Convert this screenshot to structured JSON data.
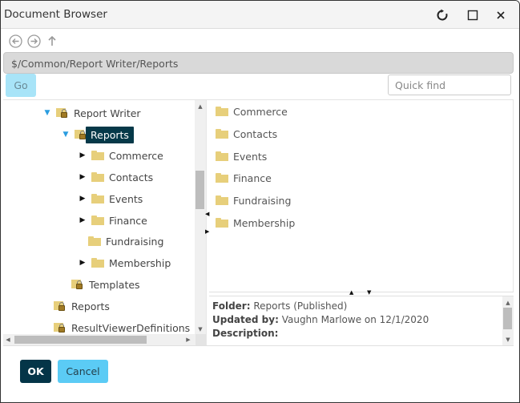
{
  "window": {
    "title": "Document Browser",
    "controls": [
      {
        "name": "refresh",
        "icon": "refresh-icon"
      },
      {
        "name": "maximize",
        "icon": "maximize-icon"
      },
      {
        "name": "close",
        "icon": "close-icon"
      }
    ]
  },
  "nav": {
    "back_icon": "back-circle-arrow-icon",
    "forward_icon": "forward-circle-arrow-icon",
    "up_icon": "up-arrow-icon"
  },
  "path": {
    "value": "$/Common/Report Writer/Reports"
  },
  "go_label": "Go",
  "quickfind": {
    "placeholder": "Quick find",
    "value": ""
  },
  "tree": {
    "items": [
      {
        "label": "Report Writer",
        "level": 0,
        "toggle": "open",
        "icon": "locked-folder-icon"
      },
      {
        "label": "Reports",
        "level": 1,
        "toggle": "open",
        "icon": "locked-folder-icon",
        "selected": true
      },
      {
        "label": "Commerce",
        "level": 2,
        "toggle": "closed",
        "icon": "folder-icon"
      },
      {
        "label": "Contacts",
        "level": 2,
        "toggle": "closed",
        "icon": "folder-icon"
      },
      {
        "label": "Events",
        "level": 2,
        "toggle": "closed",
        "icon": "folder-icon"
      },
      {
        "label": "Finance",
        "level": 2,
        "toggle": "closed",
        "icon": "folder-icon"
      },
      {
        "label": "Fundraising",
        "level": 2,
        "toggle": "none",
        "icon": "folder-icon"
      },
      {
        "label": "Membership",
        "level": 2,
        "toggle": "closed",
        "icon": "folder-icon"
      },
      {
        "label": "Templates",
        "level": 1,
        "toggle": "none",
        "icon": "locked-folder-icon"
      },
      {
        "label": "Reports",
        "level": 0,
        "toggle": "none",
        "icon": "locked-folder-icon"
      },
      {
        "label": "ResultViewerDefinitions",
        "level": 0,
        "toggle": "none",
        "icon": "locked-folder-icon"
      }
    ]
  },
  "list": {
    "items": [
      {
        "label": "Commerce",
        "icon": "folder-icon"
      },
      {
        "label": "Contacts",
        "icon": "folder-icon"
      },
      {
        "label": "Events",
        "icon": "folder-icon"
      },
      {
        "label": "Finance",
        "icon": "folder-icon"
      },
      {
        "label": "Fundraising",
        "icon": "folder-icon"
      },
      {
        "label": "Membership",
        "icon": "folder-icon"
      }
    ]
  },
  "details": {
    "folder_label": "Folder:",
    "folder_value": "Reports (Published)",
    "updated_label": "Updated by:",
    "updated_value": "Vaughn Marlowe on 12/1/2020",
    "description_label": "Description:",
    "description_value": ""
  },
  "footer": {
    "ok_label": "OK",
    "cancel_label": "Cancel"
  },
  "colors": {
    "selected_bg": "#063949",
    "ok_bg": "#043548",
    "cancel_bg": "#5bcbf5",
    "go_bg": "#a8e4f8",
    "folder": "#e7cf7b",
    "expand_arrow": "#2a9de0"
  }
}
